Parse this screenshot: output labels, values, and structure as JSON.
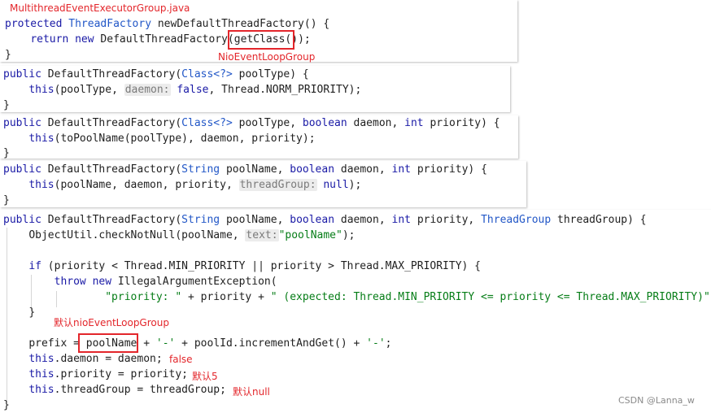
{
  "annotations": {
    "file_title": "MultithreadEventExecutorGroup.java",
    "nio_event_loop_group": "NioEventLoopGroup",
    "default_prefix": "默认nioEventLoopGroup",
    "daemon_false": "false",
    "priority_5": "默认5",
    "thread_group_null": "默认null"
  },
  "watermark": "CSDN @Lanna_w",
  "code": {
    "p1": {
      "l1": {
        "kw": "protected",
        "ty": "ThreadFactory",
        "rest": "newDefaultThreadFactory() {"
      },
      "l2": {
        "kw1": "return",
        "kw2": "new",
        "pre": "DefaultThreadFactory(",
        "boxed": "getClass()",
        "post": ");"
      },
      "l3": "}"
    },
    "p2": {
      "l1": {
        "kw": "public",
        "pre": "DefaultThreadFactory(",
        "ty": "Class<?>",
        "rest": "poolType) {"
      },
      "l2": {
        "kw": "this",
        "pre": "(poolType, ",
        "hint": "daemon:",
        "kw2": "false",
        "rest": ", Thread.NORM_PRIORITY);"
      },
      "l3": "}"
    },
    "p3": {
      "l1": {
        "kw": "public",
        "pre": "DefaultThreadFactory(",
        "ty": "Class<?>",
        "mid1": "poolType, ",
        "kw2": "boolean",
        "mid2": "daemon, ",
        "kw3": "int",
        "rest": "priority) {"
      },
      "l2": {
        "kw": "this",
        "rest": "(toPoolName(poolType), daemon, priority);"
      },
      "l3": "}"
    },
    "p4": {
      "l1": {
        "kw": "public",
        "pre": "DefaultThreadFactory(",
        "ty": "String",
        "mid1": "poolName, ",
        "kw2": "boolean",
        "mid2": "daemon, ",
        "kw3": "int",
        "rest": "priority) {"
      },
      "l2": {
        "kw": "this",
        "pre": "(poolName, daemon, priority, ",
        "hint": "threadGroup:",
        "kw2": "null",
        "rest": ");"
      },
      "l3": "}"
    },
    "p5": {
      "l1": {
        "kw": "public",
        "pre": "DefaultThreadFactory(",
        "ty": "String",
        "mid1": "poolName, ",
        "kw2": "boolean",
        "mid2": "daemon, ",
        "kw3": "int",
        "mid3": "priority, ",
        "ty2": "ThreadGroup",
        "rest": "threadGroup) {"
      },
      "l2": {
        "pre": "ObjectUtil.checkNotNull(poolName, ",
        "hint": "text:",
        "str": "\"poolName\"",
        "rest": ");"
      },
      "l3": {
        "kw": "if",
        "rest": "(priority < Thread.MIN_PRIORITY || priority > Thread.MAX_PRIORITY) {"
      },
      "l4": {
        "kw1": "throw",
        "kw2": "new",
        "rest": "IllegalArgumentException("
      },
      "l5": {
        "s1": "\"priority: \"",
        "m1": " + priority + ",
        "s2": "\" (expected: Thread.MIN_PRIORITY <= priority <= Thread.MAX_PRIORITY)\"",
        "rest": ");"
      },
      "l6": "}",
      "l7": {
        "pre": "prefix = ",
        "boxed": "poolName",
        "mid": " + ",
        "s1": "'-'",
        "m2": " + poolId.incrementAndGet() + ",
        "s2": "'-'",
        "rest": ";"
      },
      "l8": {
        "kw": "this",
        "rest": ".daemon = daemon;"
      },
      "l9": {
        "kw": "this",
        "rest": ".priority = priority;"
      },
      "l10": {
        "kw": "this",
        "rest": ".threadGroup = threadGroup;"
      },
      "l11": "}"
    }
  }
}
